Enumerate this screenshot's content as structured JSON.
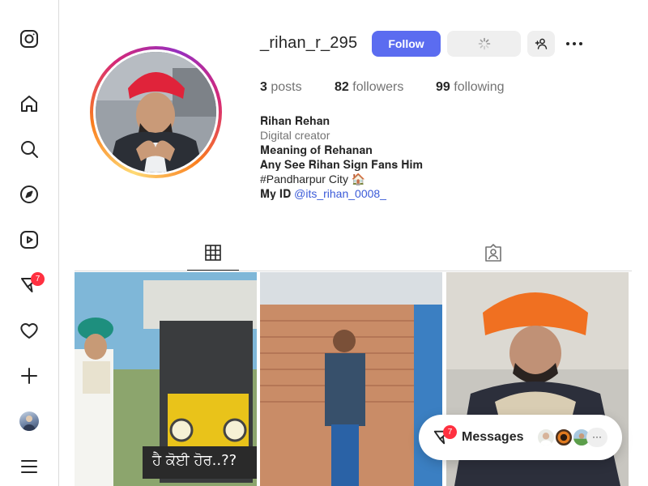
{
  "sidebar": {
    "notifications_badge": "7"
  },
  "profile": {
    "username": "_rihan_r_295",
    "follow_label": "Follow",
    "stats": {
      "posts_count": "3",
      "posts_label": "posts",
      "followers_count": "82",
      "followers_label": "followers",
      "following_count": "99",
      "following_label": "following"
    },
    "bio": {
      "line1": "𝐑𝐢𝐡𝐚𝐧 𝐑𝐞𝐡𝐚𝐧",
      "category": "Digital creator",
      "line3": "𝐌𝐞𝐚𝐧𝐢𝐧𝐠 𝐨𝐟 𝐑𝐞𝐡𝐚𝐧𝐚𝐧",
      "line4": "𝐀𝐧𝐲 𝐒𝐞𝐞 𝐑𝐢𝐡𝐚𝐧 𝐒𝐢𝐠𝐧 𝐅𝐚𝐧𝐬 𝐇𝐢𝐦",
      "line5": "#Pandharpur City 🏠",
      "line6_prefix": "𝐌𝐲 𝐈𝐃 ",
      "mention": "@its_rihan_0008_"
    }
  },
  "messages": {
    "label": "Messages",
    "badge": "7",
    "more": "···"
  },
  "colors": {
    "follow_button": "#5b6cf0",
    "badge": "#ff3040",
    "link": "#3a5ad8"
  }
}
